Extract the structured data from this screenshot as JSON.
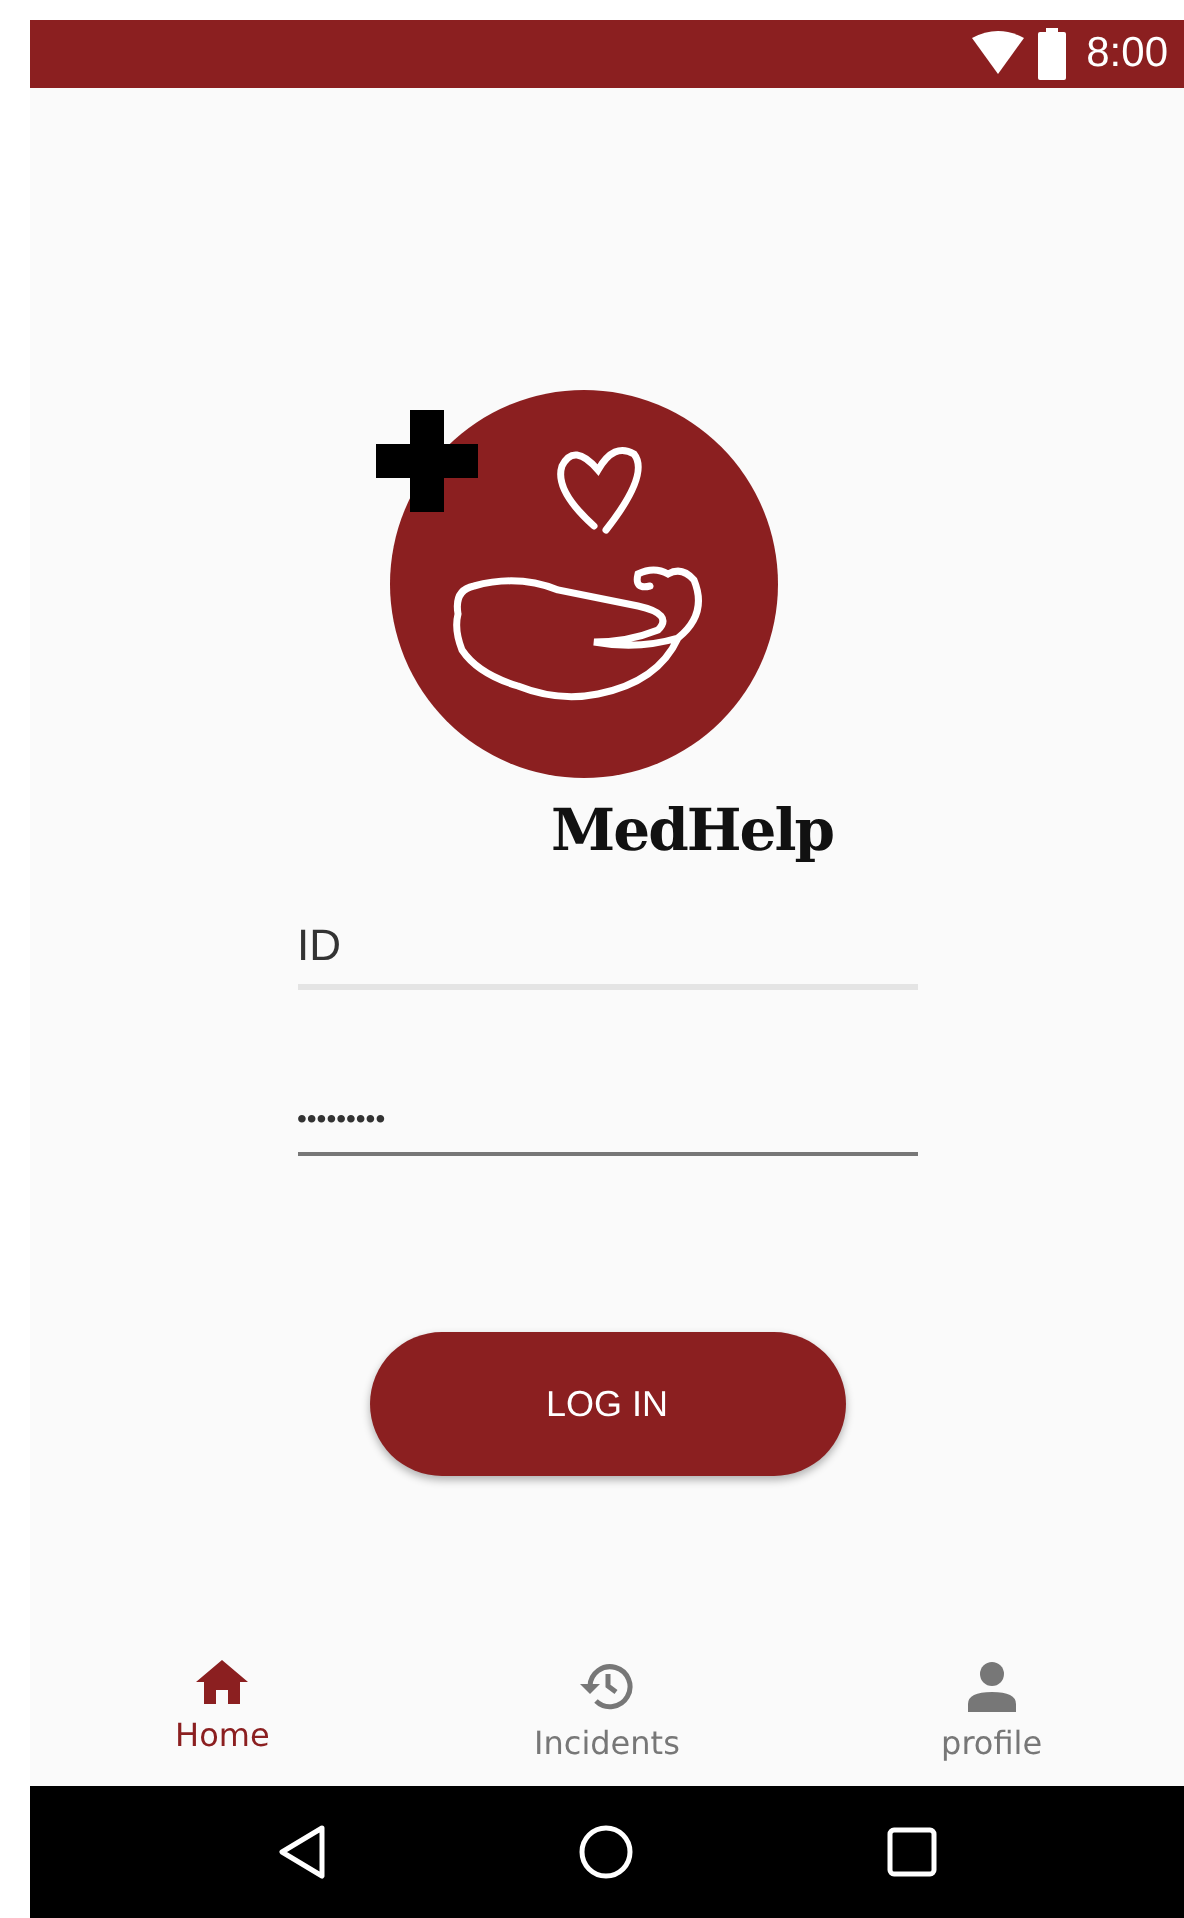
{
  "status_bar": {
    "time": "8:00"
  },
  "logo": {
    "title": "MedHelp"
  },
  "form": {
    "fields": [
      {
        "kind": "text",
        "value": "ID",
        "focused": false
      },
      {
        "kind": "password",
        "value": "•••••••••",
        "focused": true
      }
    ],
    "submit": "LOG IN"
  },
  "bottom_nav": [
    {
      "label": "Home",
      "kind": "home",
      "selected": true
    },
    {
      "label": "Incidents",
      "kind": "history",
      "selected": false
    },
    {
      "label": "profile",
      "kind": "person",
      "selected": false
    }
  ]
}
